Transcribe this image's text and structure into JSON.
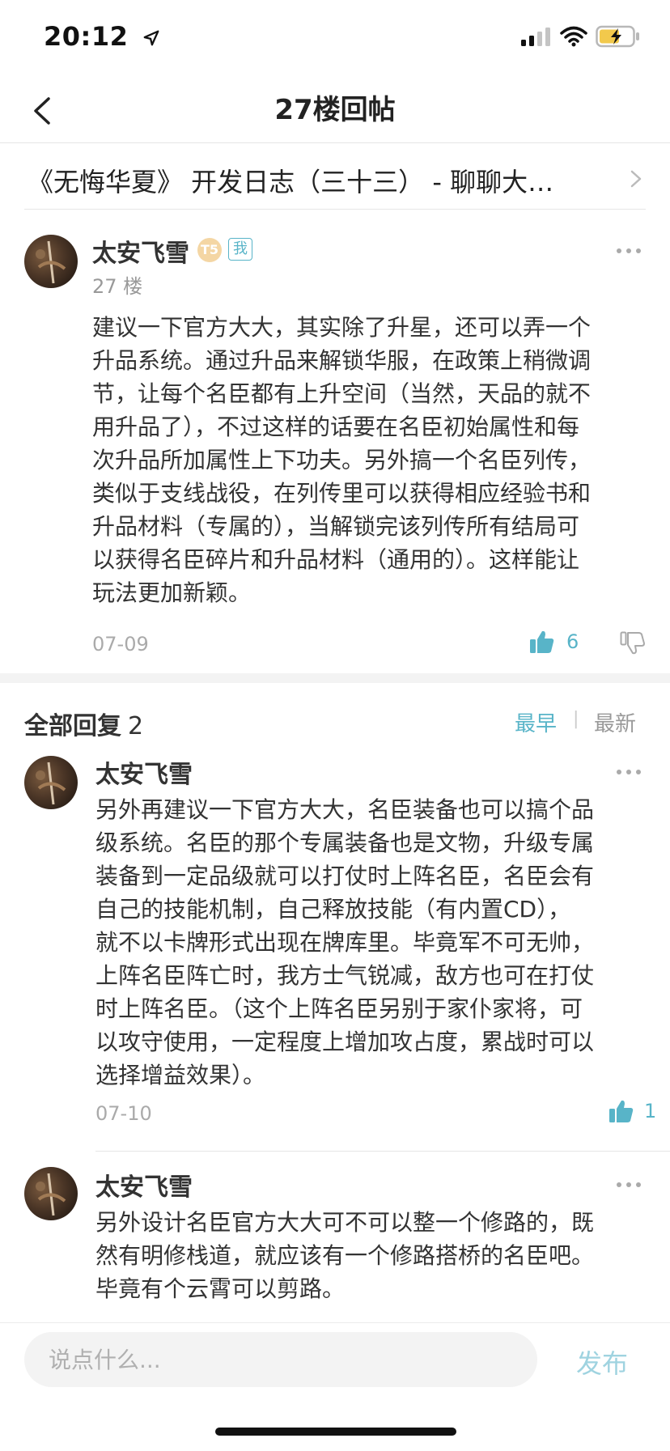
{
  "status_bar": {
    "time": "20:12"
  },
  "nav": {
    "title": "27楼回帖"
  },
  "post": {
    "title": "《无悔华夏》 开发日志（三十三） - 聊聊大…"
  },
  "floor_post": {
    "username": "太安飞雪",
    "level_badge": "T5",
    "me_badge": "我",
    "floor": "27 楼",
    "lines": [
      "建议一下官方大大，其实除了升星，还可以弄一个",
      "升品系统。通过升品来解锁华服，在政策上稍微调",
      "节，让每个名臣都有上升空间（当然，天品的就不",
      "用升品了），不过这样的话要在名臣初始属性和每",
      "次升品所加属性上下功夫。另外搞一个名臣列传，",
      "类似于支线战役，在列传里可以获得相应经验书和",
      "升品材料（专属的），当解锁完该列传所有结局可",
      "以获得名臣碎片和升品材料（通用的）。这样能让",
      "玩法更加新颖。"
    ],
    "date": "07-09",
    "likes": "6"
  },
  "replies_header": {
    "title": "全部回复",
    "count": "2",
    "sort_earliest": "最早",
    "sort_separator": "|",
    "sort_latest": "最新"
  },
  "replies": [
    {
      "username": "太安飞雪",
      "lines": [
        "另外再建议一下官方大大，名臣装备也可以搞个品",
        "级系统。名臣的那个专属装备也是文物，升级专属",
        "装备到一定品级就可以打仗时上阵名臣，名臣会有",
        "自己的技能机制，自己释放技能（有内置CD），",
        "就不以卡牌形式出现在牌库里。毕竟军不可无帅，",
        "上阵名臣阵亡时，我方士气锐减，敌方也可在打仗",
        "时上阵名臣。（这个上阵名臣另别于家仆家将，可",
        "以攻守使用，一定程度上增加攻占度，累战时可以",
        "选择增益效果）。"
      ],
      "date": "07-10",
      "likes": "1"
    },
    {
      "username": "太安飞雪",
      "lines": [
        "另外设计名臣官方大大可不可以整一个修路的，既",
        "然有明修栈道，就应该有一个修路搭桥的名臣吧。",
        "毕竟有个云霄可以剪路。"
      ]
    }
  ],
  "bottom_bar": {
    "input_placeholder": "说点什么...",
    "publish_label": "发布"
  },
  "colors": {
    "accent": "#58b4c8",
    "publish_disabled": "#9fd3e0",
    "text": "#333333",
    "muted": "#999999"
  }
}
